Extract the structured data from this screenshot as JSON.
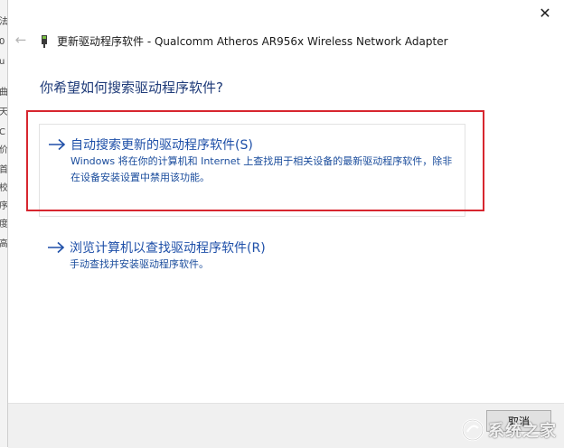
{
  "window": {
    "title": "更新驱动程序软件 - Qualcomm Atheros AR956x Wireless Network Adapter",
    "close_glyph": "✕",
    "back_glyph": "←"
  },
  "background_window": {
    "chars": [
      "法",
      "0",
      "u",
      "曲",
      "天",
      "C",
      "价",
      "首",
      "校",
      "序",
      "度",
      "高"
    ]
  },
  "page": {
    "heading": "你希望如何搜索驱动程序软件?"
  },
  "options": [
    {
      "title": "自动搜索更新的驱动程序软件(S)",
      "description": "Windows 将在你的计算机和 Internet 上查找用于相关设备的最新驱动程序软件，除非在设备安装设置中禁用该功能。"
    },
    {
      "title": "浏览计算机以查找驱动程序软件(R)",
      "description": "手动查找并安装驱动程序软件。"
    }
  ],
  "footer": {
    "cancel_label": "取消"
  },
  "watermark": {
    "text": "系统之家"
  },
  "colors": {
    "link_blue": "#1e4fa8",
    "heading_blue": "#1e3a78",
    "highlight_red": "#d7262f"
  },
  "icons": {
    "device": "network-adapter-icon",
    "option_arrow": "arrow-right-icon"
  }
}
